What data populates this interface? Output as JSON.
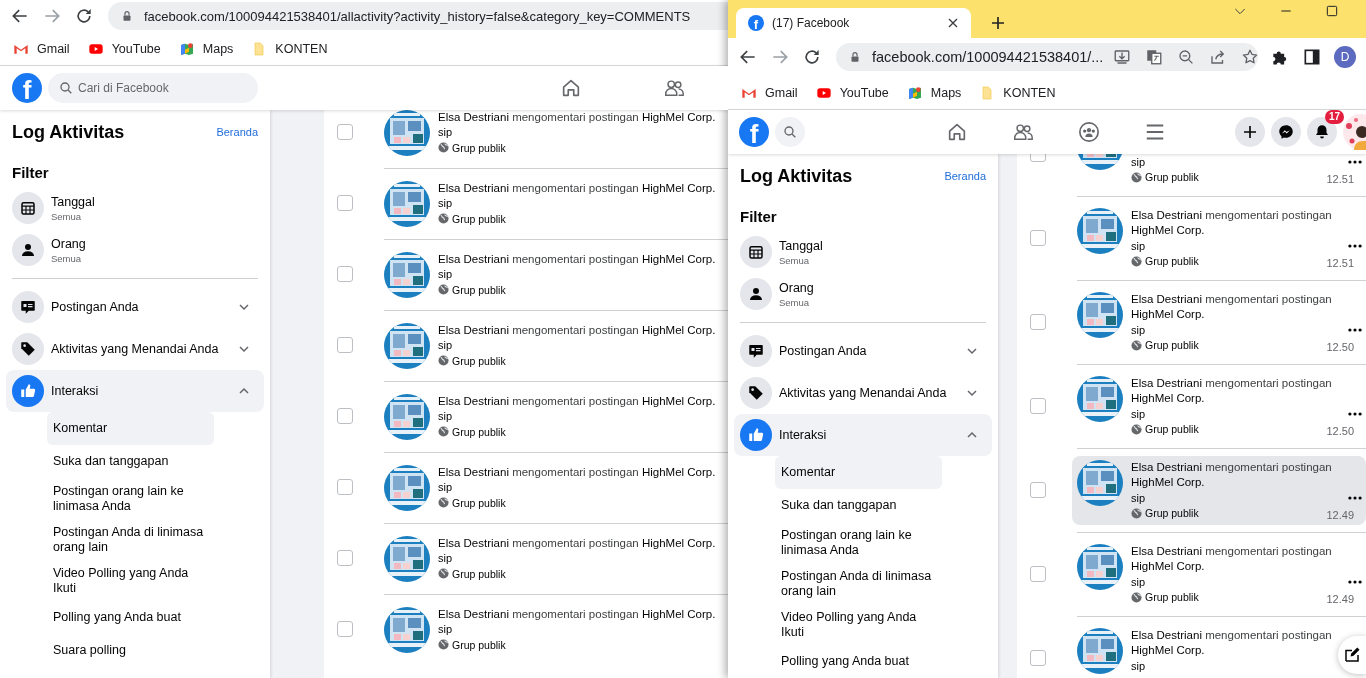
{
  "left_window": {
    "url": "facebook.com/100094421538401/allactivity?activity_history=false&category_key=COMMENTS",
    "bookmarks": [
      {
        "label": "Gmail",
        "kind": "gmail"
      },
      {
        "label": "YouTube",
        "kind": "youtube"
      },
      {
        "label": "Maps",
        "kind": "maps"
      },
      {
        "label": "KONTEN",
        "kind": "folder"
      }
    ],
    "facebook": {
      "logo": "f",
      "search_placeholder": "Cari di Facebook",
      "nav": [
        {
          "kind": "home"
        },
        {
          "kind": "friends"
        }
      ]
    },
    "sidebar": {
      "title": "Log Aktivitas",
      "link": "Beranda",
      "filter_heading": "Filter",
      "filters": [
        {
          "kind": "date",
          "label": "Tanggal",
          "value": "Semua"
        },
        {
          "kind": "person",
          "label": "Orang",
          "value": "Semua"
        }
      ],
      "categories": [
        {
          "kind": "posts",
          "label": "Postingan Anda",
          "expanded": false
        },
        {
          "kind": "tags",
          "label": "Aktivitas yang Menandai Anda",
          "expanded": false
        },
        {
          "kind": "interactions",
          "label": "Interaksi",
          "expanded": true,
          "children": [
            {
              "label": "Komentar",
              "selected": true
            },
            {
              "label": "Suka dan tanggapan",
              "selected": false
            },
            {
              "label": "Postingan orang lain ke linimasa Anda",
              "selected": false
            },
            {
              "label": "Postingan Anda di linimasa orang lain",
              "selected": false
            },
            {
              "label": "Video Polling yang Anda Ikuti",
              "selected": false
            },
            {
              "label": "Polling yang Anda buat",
              "selected": false
            },
            {
              "label": "Suara polling",
              "selected": false
            }
          ]
        }
      ]
    },
    "activities": [
      {
        "title": "**Elsa Destriani** mengomentari postingan **HighMel Corp.**",
        "comment": "sip",
        "audience": "Grup publik",
        "checked": false,
        "hovered": false
      },
      {
        "title": "**Elsa Destriani** mengomentari postingan **HighMel Corp.**",
        "comment": "sip",
        "audience": "Grup publik",
        "checked": false,
        "hovered": false
      },
      {
        "title": "**Elsa Destriani** mengomentari postingan **HighMel Corp.**",
        "comment": "sip",
        "audience": "Grup publik",
        "checked": false,
        "hovered": false
      },
      {
        "title": "**Elsa Destriani** mengomentari postingan **HighMel Corp.**",
        "comment": "sip",
        "audience": "Grup publik",
        "checked": false,
        "hovered": false
      },
      {
        "title": "**Elsa Destriani** mengomentari postingan **HighMel Corp.**",
        "comment": "sip",
        "audience": "Grup publik",
        "checked": false,
        "hovered": false
      },
      {
        "title": "**Elsa Destriani** mengomentari postingan **HighMel Corp.**",
        "comment": "sip",
        "audience": "Grup publik",
        "checked": false,
        "hovered": false
      },
      {
        "title": "**Elsa Destriani** mengomentari postingan **HighMel Corp.**",
        "comment": "sip",
        "audience": "Grup publik",
        "checked": false,
        "hovered": false
      },
      {
        "title": "**Elsa Destriani** mengomentari postingan **HighMel Corp.**",
        "comment": "sip",
        "audience": "Grup publik",
        "checked": false,
        "hovered": false
      }
    ]
  },
  "right_window": {
    "tab": {
      "favicon": "f",
      "title": "(17) Facebook"
    },
    "window_controls": [
      {
        "kind": "tab_search"
      },
      {
        "kind": "minimize"
      },
      {
        "kind": "maximize"
      }
    ],
    "url": "facebook.com/100094421538401/...",
    "address_actions": [
      {
        "kind": "install"
      },
      {
        "kind": "translate"
      },
      {
        "kind": "zoom"
      },
      {
        "kind": "share"
      },
      {
        "kind": "bookmark"
      }
    ],
    "extensions": [
      {
        "kind": "puzzle"
      },
      {
        "kind": "side_panel"
      }
    ],
    "profile_initial": "D",
    "bookmarks": [
      {
        "label": "Gmail",
        "kind": "gmail"
      },
      {
        "label": "YouTube",
        "kind": "youtube"
      },
      {
        "label": "Maps",
        "kind": "maps"
      },
      {
        "label": "KONTEN",
        "kind": "folder"
      }
    ],
    "facebook": {
      "logo": "f",
      "nav": [
        {
          "kind": "home"
        },
        {
          "kind": "friends"
        },
        {
          "kind": "groups"
        },
        {
          "kind": "menu"
        }
      ],
      "actions": [
        {
          "kind": "create"
        },
        {
          "kind": "messenger"
        },
        {
          "kind": "notifications",
          "badge": "17"
        }
      ]
    },
    "sidebar": {
      "title": "Log Aktivitas",
      "link": "Beranda",
      "filter_heading": "Filter",
      "filters": [
        {
          "kind": "date",
          "label": "Tanggal",
          "value": "Semua"
        },
        {
          "kind": "person",
          "label": "Orang",
          "value": "Semua"
        }
      ],
      "categories": [
        {
          "kind": "posts",
          "label": "Postingan Anda",
          "expanded": false
        },
        {
          "kind": "tags",
          "label": "Aktivitas yang Menandai Anda",
          "expanded": false
        },
        {
          "kind": "interactions",
          "label": "Interaksi",
          "expanded": true,
          "children": [
            {
              "label": "Komentar",
              "selected": true
            },
            {
              "label": "Suka dan tanggapan",
              "selected": false
            },
            {
              "label": "Postingan orang lain ke linimasa Anda",
              "selected": false
            },
            {
              "label": "Postingan Anda di linimasa orang lain",
              "selected": false
            },
            {
              "label": "Video Polling yang Anda Ikuti",
              "selected": false
            },
            {
              "label": "Polling yang Anda buat",
              "selected": false
            }
          ]
        }
      ]
    },
    "activities": [
      {
        "comment": "sip",
        "audience": "Grup publik",
        "time": "12.51",
        "checked": false,
        "hovered": false
      },
      {
        "title": "**Elsa Destriani** mengomentari postingan **HighMel Corp.**",
        "comment": "sip",
        "audience": "Grup publik",
        "time": "12.51",
        "checked": false,
        "hovered": false
      },
      {
        "title": "**Elsa Destriani** mengomentari postingan **HighMel Corp.**",
        "comment": "sip",
        "audience": "Grup publik",
        "time": "12.50",
        "checked": false,
        "hovered": false
      },
      {
        "title": "**Elsa Destriani** mengomentari postingan **HighMel Corp.**",
        "comment": "sip",
        "audience": "Grup publik",
        "time": "12.50",
        "checked": false,
        "hovered": false
      },
      {
        "title": "**Elsa Destriani** mengomentari postingan **HighMel Corp.**",
        "comment": "sip",
        "audience": "Grup publik",
        "time": "12.49",
        "checked": false,
        "hovered": true
      },
      {
        "title": "**Elsa Destriani** mengomentari postingan **HighMel Corp.**",
        "comment": "sip",
        "audience": "Grup publik",
        "time": "12.49",
        "checked": false,
        "hovered": false
      },
      {
        "title": "**Elsa Destriani** mengomentari postingan **HighMel Corp.**",
        "comment": "sip",
        "checked": false,
        "hovered": false
      }
    ],
    "compose_button": true
  }
}
